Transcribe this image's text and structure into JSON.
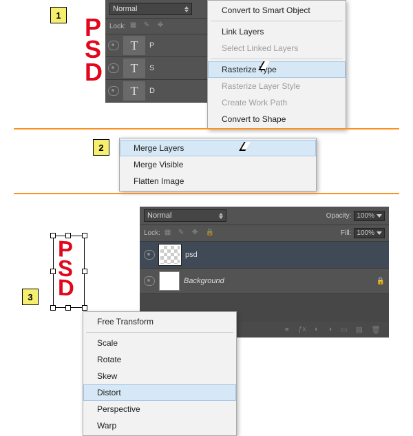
{
  "steps": {
    "s1": "1",
    "s2": "2",
    "s3": "3"
  },
  "psd": {
    "p": "P",
    "s": "S",
    "d": "D"
  },
  "panel1": {
    "blend": "Normal",
    "lockLabel": "Lock:",
    "layers": [
      {
        "t": "T",
        "n": "P"
      },
      {
        "t": "T",
        "n": "S"
      },
      {
        "t": "T",
        "n": "D"
      }
    ]
  },
  "ctx1": {
    "convertSmart": "Convert to Smart Object",
    "linkLayers": "Link Layers",
    "selectLinked": "Select Linked Layers",
    "rasterizeType": "Rasterize Type",
    "rasterizeStyle": "Rasterize Layer Style",
    "createPath": "Create Work Path",
    "convertShape": "Convert to Shape"
  },
  "ctx2": {
    "mergeLayers": "Merge Layers",
    "mergeVisible": "Merge Visible",
    "flatten": "Flatten Image"
  },
  "panel3": {
    "blend": "Normal",
    "opacityLabel": "Opacity:",
    "opacityVal": "100%",
    "lockLabel": "Lock:",
    "fillLabel": "Fill:",
    "fillVal": "100%",
    "layer1": "psd",
    "layer2": "Background"
  },
  "ctx3": {
    "free": "Free Transform",
    "scale": "Scale",
    "rotate": "Rotate",
    "skew": "Skew",
    "distort": "Distort",
    "perspective": "Perspective",
    "warp": "Warp"
  }
}
